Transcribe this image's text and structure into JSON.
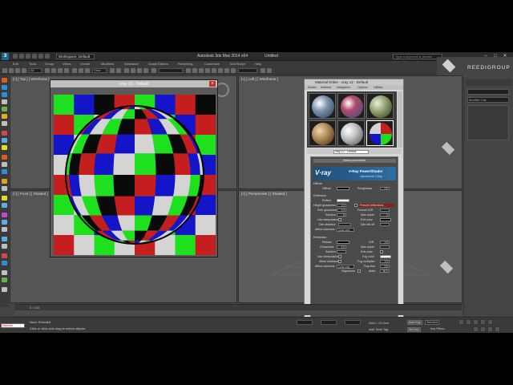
{
  "titlebar": {
    "workspace": "Workspace: Default",
    "app_title": "Autodesk 3ds Max  2014 x64",
    "file_title": "Untitled",
    "search_placeholder": "Type a keyword or phrase"
  },
  "menubar": [
    "Edit",
    "Tools",
    "Group",
    "Views",
    "Create",
    "Modifiers",
    "Animation",
    "Graph Editors",
    "Rendering",
    "Customize",
    "MAXScript",
    "Help"
  ],
  "brand": {
    "text": "REEDIGROUP"
  },
  "command_panel": {
    "modifier_list": "Modifier List"
  },
  "viewports": {
    "top": "[+] [ Top ] [ Wireframe ]",
    "left": "[+] [ Left ] [ Wireframe ]",
    "front": "[+] [ Front ] [ Shaded ]",
    "perspective": "[+] [ Perspective ] [ Shaded ]"
  },
  "render_window": {
    "title": "vray 12 - Default",
    "close": "x"
  },
  "material_editor": {
    "title": "Material Editor - vray 12 - Default",
    "menu": [
      "Modes",
      "Material",
      "Navigation",
      "Options",
      "Utilities"
    ],
    "material_name": "vray 12 - Default",
    "basic_params": "Basic parameters",
    "vray_logo": "V·ray",
    "powershader": "V-Ray PowerShader",
    "optimized": "optimized for V-Ray",
    "diffuse_group": "Diffuse",
    "diffuse": "Diffuse",
    "roughness": "Roughness",
    "roughness_val": "0.0",
    "reflection_group": "Reflection",
    "reflect": "Reflect",
    "hilight_gloss": "Hilight glossiness",
    "hilight_gloss_val": "1.0",
    "refl_gloss": "Refl. glossiness",
    "refl_gloss_val": "1.0",
    "subdivs": "Subdivs",
    "subdivs_val": "8",
    "use_interp": "Use interpolation",
    "dim_distance": "Dim distance",
    "affect_channels": "Affect channels",
    "color_only": "Color only",
    "fresnel": "Fresnel reflections",
    "fresnel_ior": "Fresnel IOR",
    "max_depth": "Max depth",
    "max_depth_val": "5",
    "exit_color": "Exit color",
    "dim_falloff": "Dim fall off",
    "refraction_group": "Refraction",
    "refract": "Refract",
    "ior": "IOR",
    "ior_val": "1.6",
    "glossiness": "Glossiness",
    "glossiness_val": "1.0",
    "refr_max_depth": "Max depth",
    "refr_subdivs": "Subdivs",
    "refr_use_interp": "Use interpolation",
    "affect_shadows": "Affect shadows",
    "refr_affect_channels": "Affect channels",
    "fog_color": "Fog color",
    "fog_multiplier": "Fog multiplier",
    "fog_bias": "Fog bias",
    "fog_mult_val": "1.0",
    "fog_bias_val": "0.0",
    "dispersion": "Dispersion",
    "abbe": "Abbe",
    "abbe_val": "50.0"
  },
  "timeline": {
    "label": "0 / 100"
  },
  "status": {
    "maxscript": "Welcom",
    "line1": "None Selected",
    "line2": "Click or click-and-drag to select objects",
    "grid": "Grid = 10.0cm",
    "auto_key": "Auto Key",
    "selected": "Selected",
    "set_key": "Set Key",
    "key_filters": "Key Filters...",
    "add_time_tag": "Add Time Tag"
  },
  "colors": {
    "checker_white": "#d4d4d4",
    "checker_red": "#c41e1e",
    "checker_green": "#1fe01f",
    "checker_blue": "#1414c8",
    "checker_black": "#0a0a0a"
  }
}
